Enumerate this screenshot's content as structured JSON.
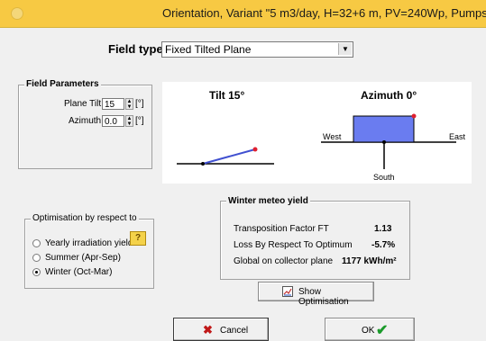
{
  "window": {
    "title": "Orientation, Variant \"5 m3/day, H=32+6 m, PV=240Wp, Pumps:"
  },
  "field_type": {
    "label": "Field type",
    "value": "Fixed Tilted Plane"
  },
  "field_parameters": {
    "title": "Field Parameters",
    "tilt_label": "Plane Tilt",
    "tilt_value": "15",
    "azimuth_label": "Azimuth",
    "azimuth_value": "0.0",
    "unit": "[°]"
  },
  "diagram": {
    "tilt_title": "Tilt 15°",
    "azimuth_title": "Azimuth 0°",
    "west": "West",
    "east": "East",
    "south": "South",
    "accent_color": "#6a7cf0",
    "marker_color": "#e02030"
  },
  "optimisation": {
    "title": "Optimisation by respect to",
    "options": [
      "Yearly irradiation yield",
      "Summer (Apr-Sep)",
      "Winter (Oct-Mar)"
    ],
    "selected_index": 2,
    "help_label": "?"
  },
  "meteo": {
    "title": "Winter meteo yield",
    "rows": [
      {
        "label": "Transposition Factor FT",
        "value": "1.13"
      },
      {
        "label": "Loss By Respect To Optimum",
        "value": "-5.7%"
      },
      {
        "label": "Global on collector plane",
        "value": "1177 kWh/m²"
      }
    ]
  },
  "buttons": {
    "show_optimisation": "Show Optimisation",
    "cancel": "Cancel",
    "ok": "OK"
  }
}
